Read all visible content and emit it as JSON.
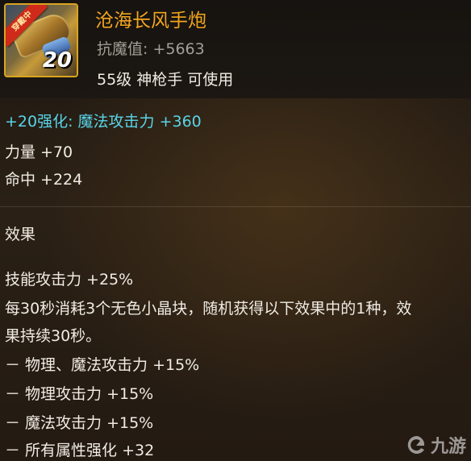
{
  "item": {
    "icon_badge": "穿戴中",
    "icon_level": "20",
    "name": "沧海长风手炮",
    "resist": "抗魔值: +5663",
    "requirement": "55级 神枪手 可使用"
  },
  "stats": {
    "enhance": "+20强化: 魔法攻击力 +360",
    "strength": "力量 +70",
    "hit": "命中 +224"
  },
  "effects": {
    "title": "效果",
    "lines": [
      "技能攻击力 +25%",
      "每30秒消耗3个无色小晶块，随机获得以下效果中的1种，效",
      "果持续30秒。",
      "－ 物理、魔法攻击力 +15%",
      "－ 物理攻击力 +15%",
      "－ 魔法攻击力 +15%",
      "－ 所有属性强化 +32"
    ]
  },
  "watermark": {
    "text": "九游",
    "icon": "jiuyou-logo-icon"
  },
  "colors": {
    "item_name": "#f2a51e",
    "enhance": "#59d4e8",
    "resist": "#a39e96"
  }
}
